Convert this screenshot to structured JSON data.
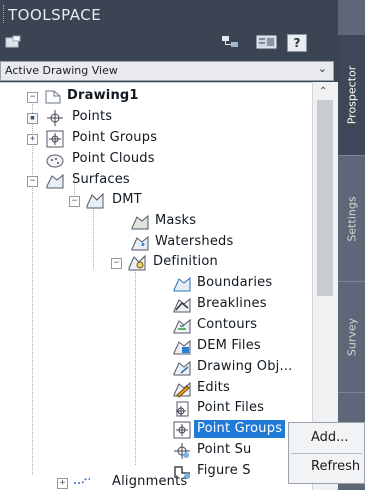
{
  "header": {
    "title": "TOOLSPACE"
  },
  "toolbar": {
    "icons": [
      "toolspace-view-icon",
      "tree-view-icon",
      "item-view-icon",
      "help-icon"
    ],
    "help_label": "?"
  },
  "view_selector": {
    "value": "Active Drawing View"
  },
  "tree": {
    "drawing": "Drawing1",
    "points": "Points",
    "point_groups": "Point Groups",
    "point_clouds": "Point Clouds",
    "surfaces": "Surfaces",
    "dmt": "DMT",
    "masks": "Masks",
    "watersheds": "Watersheds",
    "definition": "Definition",
    "boundaries": "Boundaries",
    "breaklines": "Breaklines",
    "contours": "Contours",
    "dem_files": "DEM Files",
    "drawing_objects": "Drawing Obj...",
    "edits": "Edits",
    "point_files": "Point Files",
    "def_point_groups": "Point Groups",
    "point_su": "Point Su",
    "figure_s": "Figure S",
    "alignments": "Alignments"
  },
  "side_tabs": [
    "Prospector",
    "Settings",
    "Survey"
  ],
  "context_menu": {
    "add": "Add...",
    "refresh": "Refresh"
  },
  "colors": {
    "selection": "#1f7ad8",
    "chrome": "#3b4453"
  }
}
